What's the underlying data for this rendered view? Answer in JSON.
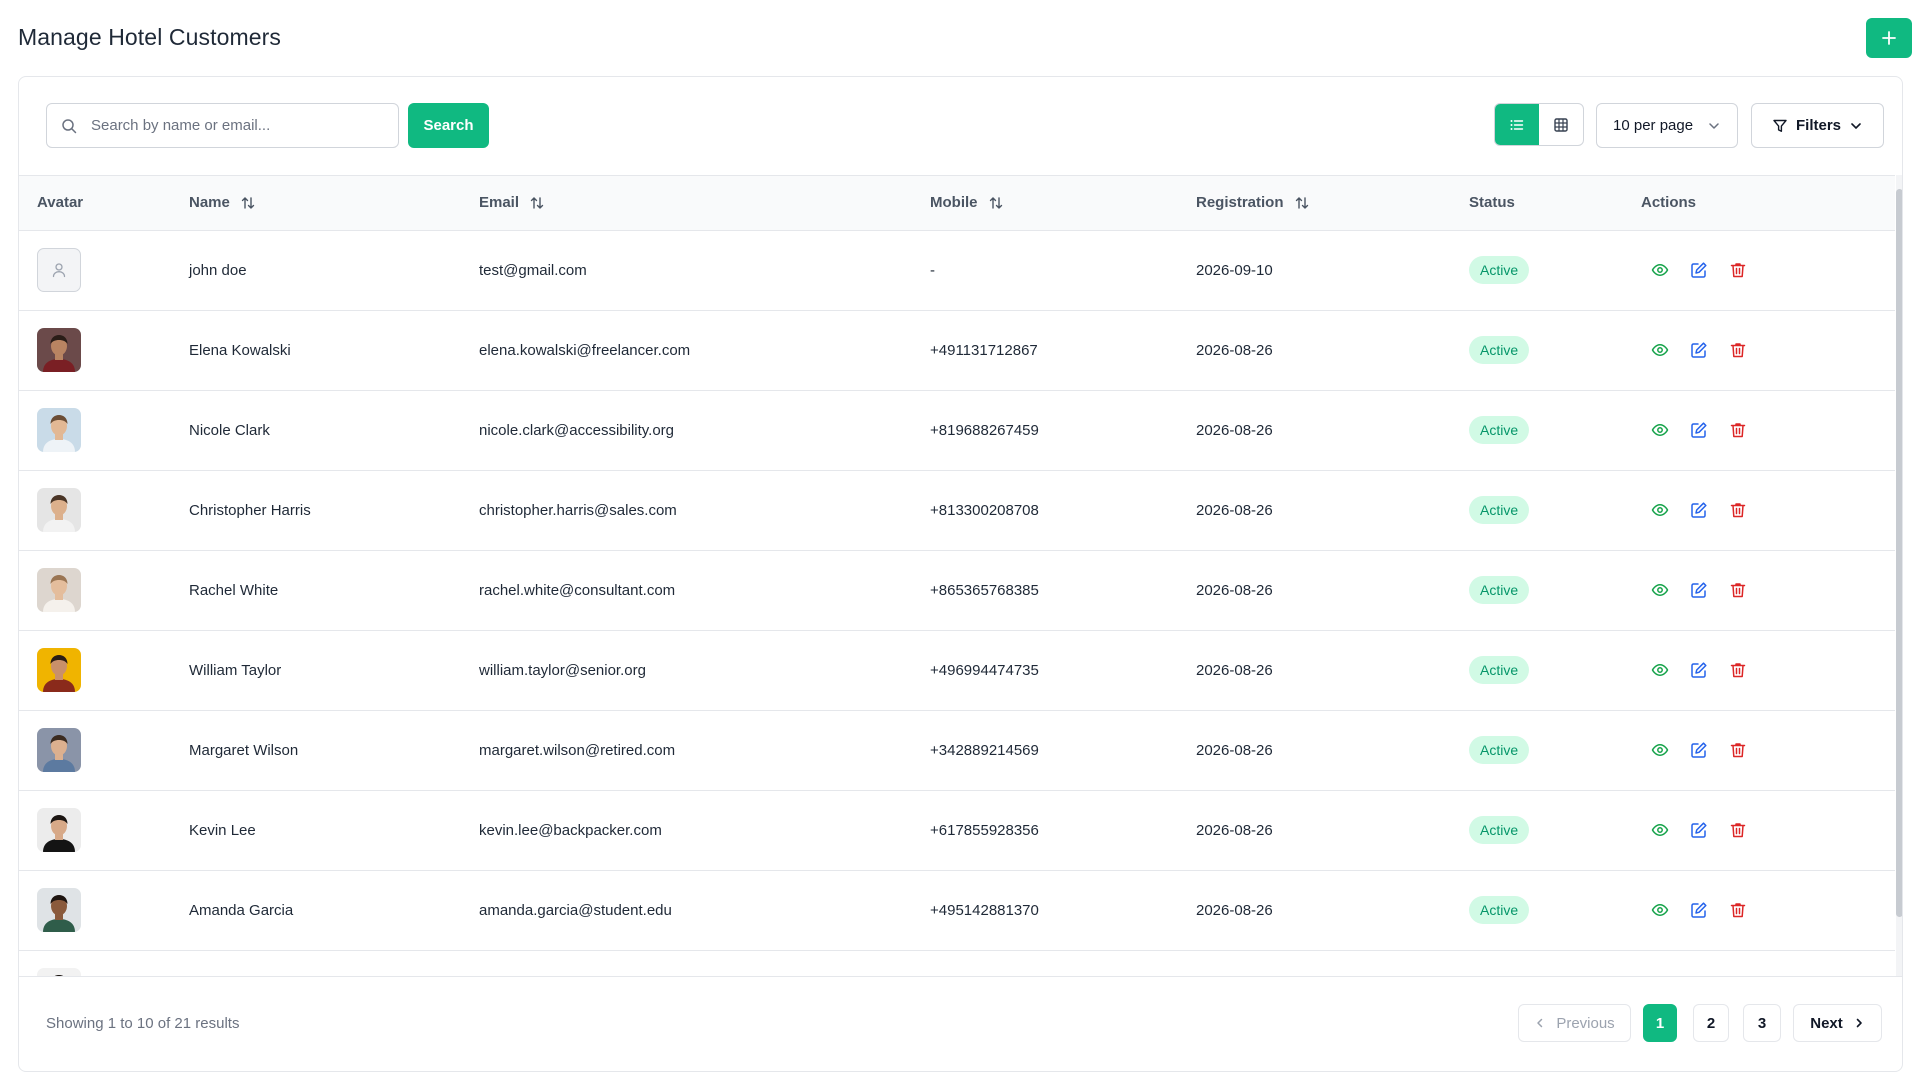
{
  "page": {
    "title": "Manage Hotel Customers",
    "add_icon": "plus-icon"
  },
  "toolbar": {
    "search_placeholder": "Search by name or email...",
    "search_value": "",
    "search_label": "Search",
    "view_modes": [
      "list",
      "grid"
    ],
    "active_view": "list",
    "per_page": "10 per page",
    "filters_label": "Filters"
  },
  "table": {
    "columns": {
      "avatar": "Avatar",
      "name": "Name",
      "email": "Email",
      "mobile": "Mobile",
      "registration": "Registration",
      "status": "Status",
      "actions": "Actions"
    },
    "sortable": [
      "name",
      "email",
      "mobile",
      "registration"
    ],
    "rows": [
      {
        "name": "john doe",
        "email": "test@gmail.com",
        "mobile": "-",
        "registration": "2026-09-10",
        "status": "Active",
        "avatar": {
          "type": "placeholder"
        }
      },
      {
        "name": "Elena Kowalski",
        "email": "elena.kowalski@freelancer.com",
        "mobile": "+491131712867",
        "registration": "2026-08-26",
        "status": "Active",
        "avatar": {
          "type": "photo",
          "bg": "#6b4a4a",
          "skin": "#b98462",
          "hair": "#2a1d18",
          "shirt": "#7a1f24"
        }
      },
      {
        "name": "Nicole Clark",
        "email": "nicole.clark@accessibility.org",
        "mobile": "+819688267459",
        "registration": "2026-08-26",
        "status": "Active",
        "avatar": {
          "type": "photo",
          "bg": "#c9dbe8",
          "skin": "#e2b894",
          "hair": "#6b4d35",
          "shirt": "#eef3f7"
        }
      },
      {
        "name": "Christopher Harris",
        "email": "christopher.harris@sales.com",
        "mobile": "+813300208708",
        "registration": "2026-08-26",
        "status": "Active",
        "avatar": {
          "type": "photo",
          "bg": "#e5e5e5",
          "skin": "#dcb08c",
          "hair": "#4a3526",
          "shirt": "#f2f2f2"
        }
      },
      {
        "name": "Rachel White",
        "email": "rachel.white@consultant.com",
        "mobile": "+865365768385",
        "registration": "2026-08-26",
        "status": "Active",
        "avatar": {
          "type": "photo",
          "bg": "#ddd6cf",
          "skin": "#e4bd9c",
          "hair": "#9a7553",
          "shirt": "#f5f1ec"
        }
      },
      {
        "name": "William Taylor",
        "email": "william.taylor@senior.org",
        "mobile": "+496994474735",
        "registration": "2026-08-26",
        "status": "Active",
        "avatar": {
          "type": "photo",
          "bg": "#f0b400",
          "skin": "#c9906a",
          "hair": "#2b1d14",
          "shirt": "#8a2a1b"
        }
      },
      {
        "name": "Margaret Wilson",
        "email": "margaret.wilson@retired.com",
        "mobile": "+342889214569",
        "registration": "2026-08-26",
        "status": "Active",
        "avatar": {
          "type": "photo",
          "bg": "#8a94a8",
          "skin": "#dcb08f",
          "hair": "#3b2b20",
          "shirt": "#5c7aa0"
        }
      },
      {
        "name": "Kevin Lee",
        "email": "kevin.lee@backpacker.com",
        "mobile": "+617855928356",
        "registration": "2026-08-26",
        "status": "Active",
        "avatar": {
          "type": "photo",
          "bg": "#ececec",
          "skin": "#d7a988",
          "hair": "#1b1512",
          "shirt": "#141414"
        }
      },
      {
        "name": "Amanda Garcia",
        "email": "amanda.garcia@student.edu",
        "mobile": "+495142881370",
        "registration": "2026-08-26",
        "status": "Active",
        "avatar": {
          "type": "photo",
          "bg": "#dfe3e6",
          "skin": "#8a5a3c",
          "hair": "#1d1410",
          "shirt": "#2f5d4a"
        }
      },
      {
        "name": "",
        "email": "",
        "mobile": "",
        "registration": "",
        "status": "",
        "avatar": {
          "type": "photo",
          "bg": "#f2f2f2",
          "skin": "#cfa080",
          "hair": "#1e1814",
          "shirt": "#e9e9e9"
        }
      }
    ]
  },
  "footer": {
    "showing": "Showing 1 to 10 of 21 results",
    "previous": "Previous",
    "pages": [
      "1",
      "2",
      "3"
    ],
    "current_page": "1",
    "next": "Next"
  },
  "colors": {
    "accent": "#10b981",
    "status_active_bg": "#d1fae5",
    "status_active_text": "#059669",
    "view_icon": "#16a34a",
    "edit_icon": "#2563eb",
    "delete_icon": "#dc2626"
  }
}
